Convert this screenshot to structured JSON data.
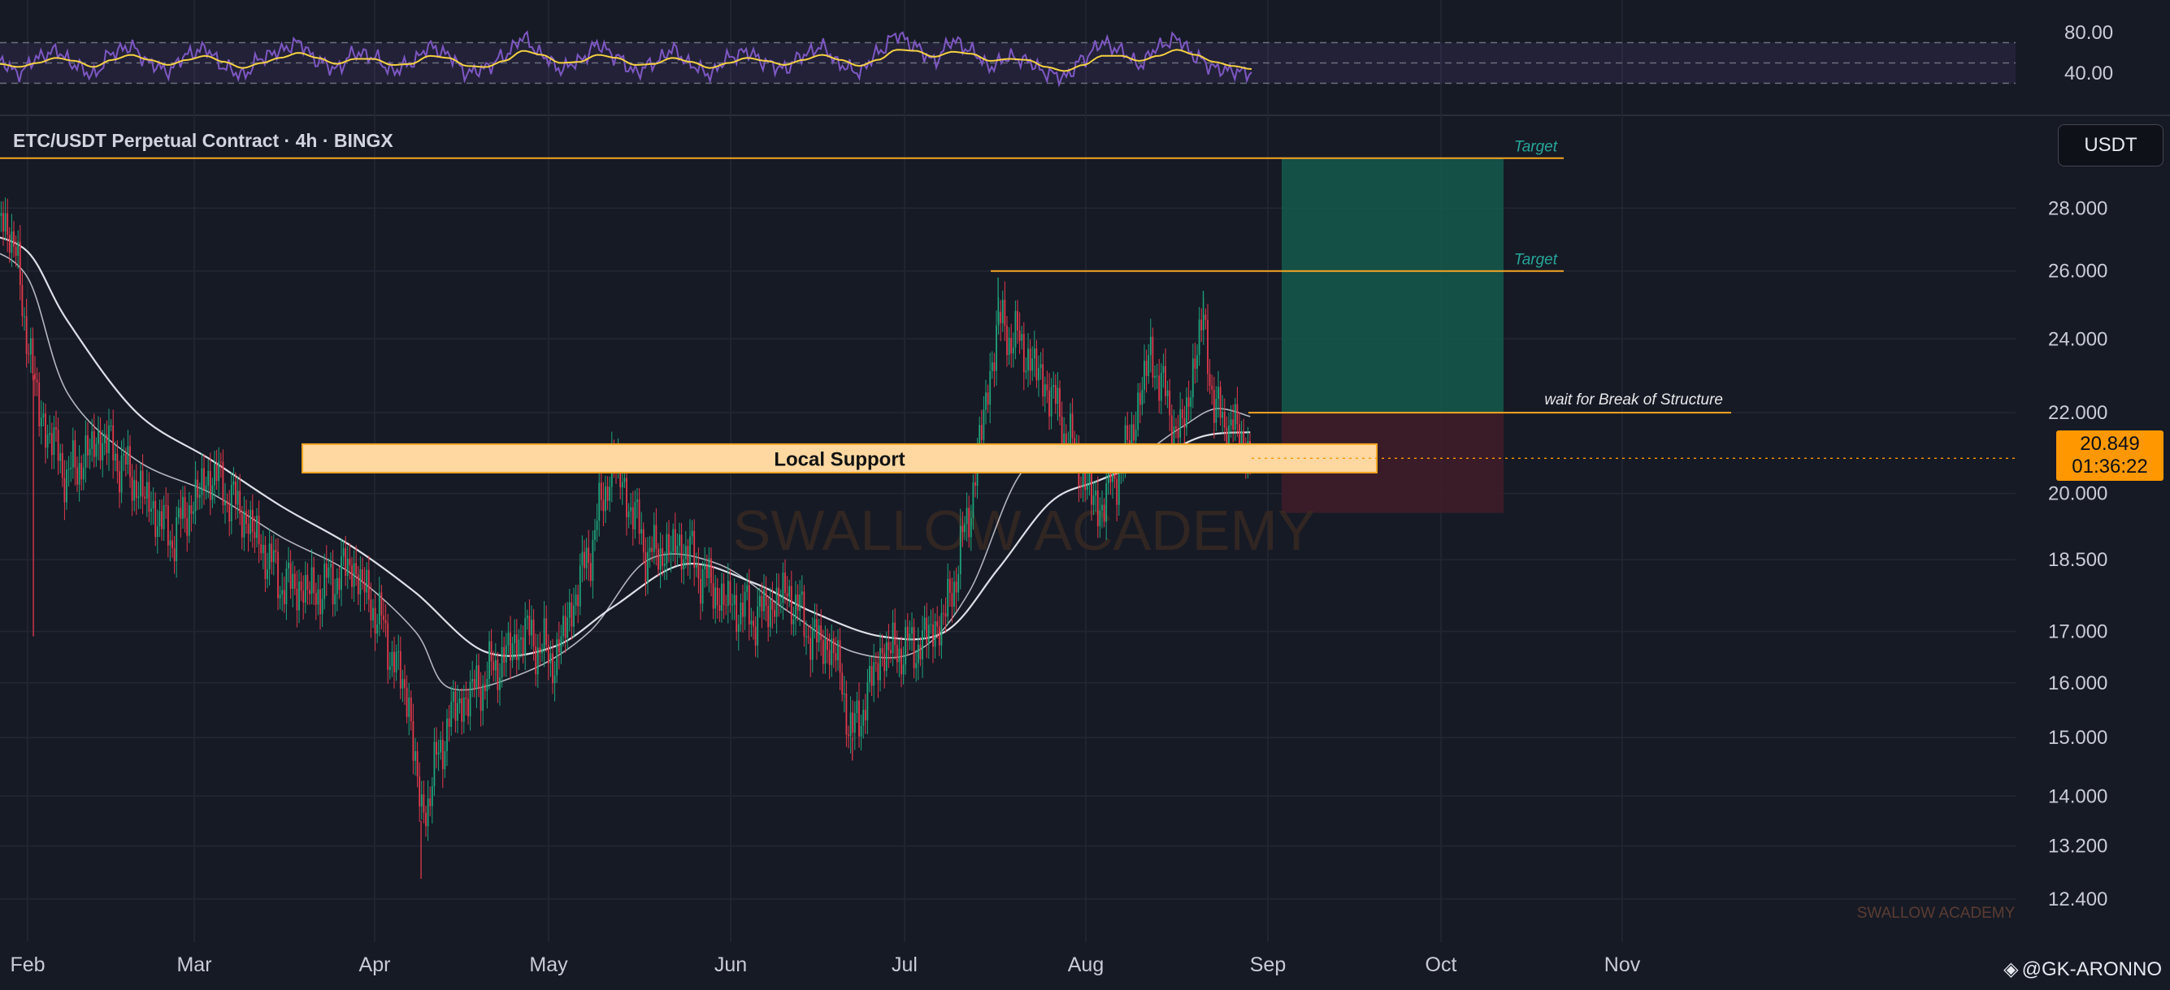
{
  "chart_title": "ETC/USDT Perpetual Contract · 4h · BINGX",
  "currency_button": "USDT",
  "last_price": "20.849",
  "countdown": "01:36:22",
  "watermark": "SWALLOW ACADEMY",
  "watermark_small": "SWALLOW ACADEMY",
  "attribution": "@GK-ARONNO",
  "colors": {
    "background": "#161a25",
    "up_candle": "#1fa37a",
    "down_candle": "#e0394b",
    "ma_fast": "#e8eaf0",
    "ma_slow": "#e8eaf0",
    "rsi_line": "#7e57c2",
    "rsi_ma": "#f5d142",
    "level_lines": "#f5a623",
    "profit_zone": "#145a4c",
    "loss_zone": "#3d1d29",
    "support_zone": "#ffd7a1",
    "price_tag": "#ff9800"
  },
  "annotations": {
    "target_1": "Target",
    "target_2": "Target",
    "break_of_structure": "wait for Break of Structure",
    "support": "Local Support"
  },
  "chart_data": [
    {
      "type": "line",
      "name": "RSI",
      "y_ticks": [
        "80.00",
        "40.00"
      ],
      "ylim": [
        20,
        100
      ],
      "overbought": 70,
      "oversold": 30,
      "series": [
        {
          "values": [
            52,
            40,
            55,
            62,
            48,
            38,
            60,
            66,
            50,
            42,
            58,
            64,
            46,
            38,
            55,
            62,
            70,
            52,
            44,
            60,
            56,
            42,
            50,
            66,
            58,
            40,
            45,
            57,
            75,
            58,
            44,
            52,
            68,
            56,
            41,
            50,
            63,
            48,
            39,
            55,
            61,
            50,
            44,
            58,
            66,
            48,
            41,
            60,
            78,
            66,
            52,
            72,
            62,
            46,
            56,
            52,
            40,
            36,
            54,
            70,
            62,
            48,
            66,
            74,
            56,
            45,
            42,
            40
          ]
        },
        {
          "values": [
            49,
            46,
            50,
            55,
            52,
            46,
            53,
            58,
            53,
            48,
            53,
            57,
            51,
            45,
            50,
            55,
            60,
            55,
            49,
            54,
            54,
            48,
            49,
            57,
            55,
            47,
            46,
            52,
            62,
            58,
            50,
            51,
            58,
            55,
            48,
            49,
            55,
            51,
            45,
            50,
            55,
            52,
            48,
            53,
            58,
            53,
            47,
            53,
            63,
            62,
            56,
            61,
            59,
            52,
            54,
            53,
            46,
            42,
            48,
            57,
            57,
            52,
            57,
            63,
            58,
            51,
            47,
            44
          ]
        }
      ]
    },
    {
      "type": "candlestick",
      "x_ticks": [
        "Feb",
        "Mar",
        "Apr",
        "May",
        "Jun",
        "Jul",
        "Aug",
        "Sep",
        "Oct",
        "Nov"
      ],
      "y_ticks": [
        "28.000",
        "26.000",
        "24.000",
        "22.000",
        "20.000",
        "18.500",
        "17.000",
        "16.000",
        "15.000",
        "14.000",
        "13.200",
        "12.400"
      ],
      "y_scale": "log",
      "ylim": [
        11.9,
        31.0
      ],
      "levels": {
        "target_1": 29.7,
        "target_2": 26.0,
        "break_of_structure": 22.0,
        "support_low": 20.5,
        "support_high": 21.2,
        "stop": 19.55
      },
      "close_path": [
        [
          "Jan 24",
          26.5
        ],
        [
          "Jan 29",
          27.6
        ],
        [
          "Feb 3",
          22.0
        ],
        [
          "Feb 8",
          20.4
        ],
        [
          "Feb 14",
          21.4
        ],
        [
          "Feb 20",
          20.2
        ],
        [
          "Feb 26",
          19.0
        ],
        [
          "Mar 4",
          20.5
        ],
        [
          "Mar 10",
          19.4
        ],
        [
          "Mar 16",
          18.0
        ],
        [
          "Mar 22",
          17.8
        ],
        [
          "Mar 28",
          18.4
        ],
        [
          "Apr 2",
          17.2
        ],
        [
          "Apr 7",
          15.6
        ],
        [
          "Apr 9",
          13.6
        ],
        [
          "Apr 14",
          15.4
        ],
        [
          "Apr 21",
          16.2
        ],
        [
          "Apr 27",
          17.0
        ],
        [
          "May 2",
          16.4
        ],
        [
          "May 8",
          18.7
        ],
        [
          "May 12",
          20.8
        ],
        [
          "May 18",
          18.6
        ],
        [
          "May 24",
          18.8
        ],
        [
          "May 30",
          17.7
        ],
        [
          "Jun 5",
          17.3
        ],
        [
          "Jun 11",
          17.8
        ],
        [
          "Jun 15",
          16.9
        ],
        [
          "Jun 19",
          16.6
        ],
        [
          "Jun 22",
          15.0
        ],
        [
          "Jun 27",
          16.6
        ],
        [
          "Jul 3",
          16.7
        ],
        [
          "Jul 8",
          17.3
        ],
        [
          "Jul 12",
          19.5
        ],
        [
          "Jul 17",
          24.5
        ],
        [
          "Jul 21",
          23.8
        ],
        [
          "Jul 26",
          22.5
        ],
        [
          "Jul 31",
          20.6
        ],
        [
          "Aug 3",
          19.6
        ],
        [
          "Aug 8",
          21.0
        ],
        [
          "Aug 12",
          23.6
        ],
        [
          "Aug 17",
          21.3
        ],
        [
          "Aug 21",
          24.6
        ],
        [
          "Aug 23",
          22.0
        ],
        [
          "Aug 27",
          21.5
        ],
        [
          "Aug 29",
          20.85
        ]
      ],
      "ma_fast": [
        [
          "Jan 24",
          26.8
        ],
        [
          "Feb 1",
          25.8
        ],
        [
          "Feb 8",
          22.5
        ],
        [
          "Feb 20",
          20.8
        ],
        [
          "Mar 4",
          20.0
        ],
        [
          "Mar 16",
          19.0
        ],
        [
          "Mar 28",
          18.2
        ],
        [
          "Apr 8",
          17.0
        ],
        [
          "Apr 14",
          15.9
        ],
        [
          "Apr 27",
          16.2
        ],
        [
          "May 8",
          17.0
        ],
        [
          "May 18",
          18.5
        ],
        [
          "May 30",
          18.4
        ],
        [
          "Jun 11",
          17.4
        ],
        [
          "Jun 22",
          16.6
        ],
        [
          "Jul 3",
          16.6
        ],
        [
          "Jul 12",
          17.8
        ],
        [
          "Jul 21",
          20.5
        ],
        [
          "Jul 31",
          21.1
        ],
        [
          "Aug 8",
          20.8
        ],
        [
          "Aug 17",
          21.6
        ],
        [
          "Aug 23",
          22.1
        ],
        [
          "Aug 29",
          21.9
        ]
      ],
      "ma_slow": [
        [
          "Jan 24",
          27.2
        ],
        [
          "Feb 1",
          26.6
        ],
        [
          "Feb 8",
          24.5
        ],
        [
          "Feb 20",
          22.0
        ],
        [
          "Mar 4",
          20.8
        ],
        [
          "Mar 16",
          19.7
        ],
        [
          "Mar 28",
          18.8
        ],
        [
          "Apr 8",
          17.8
        ],
        [
          "Apr 20",
          16.6
        ],
        [
          "May 2",
          16.7
        ],
        [
          "May 12",
          17.5
        ],
        [
          "May 24",
          18.4
        ],
        [
          "Jun 5",
          18.0
        ],
        [
          "Jun 15",
          17.4
        ],
        [
          "Jun 27",
          16.9
        ],
        [
          "Jul 8",
          17.0
        ],
        [
          "Jul 17",
          18.3
        ],
        [
          "Jul 26",
          19.8
        ],
        [
          "Aug 3",
          20.3
        ],
        [
          "Aug 12",
          20.8
        ],
        [
          "Aug 21",
          21.4
        ],
        [
          "Aug 29",
          21.5
        ]
      ]
    }
  ]
}
